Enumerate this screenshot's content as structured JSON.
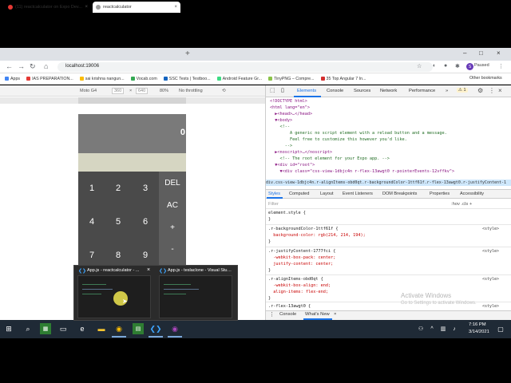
{
  "browser": {
    "tabs": [
      {
        "title": "(11) reactcalculator on Expo Dev..."
      },
      {
        "title": "reactcalculator"
      }
    ],
    "new_tab_glyph": "+",
    "url": "localhost:19006",
    "profile_initial": "S",
    "profile_status": "Paused",
    "bookmarks": [
      {
        "label": "Apps",
        "color": "#4285f4"
      },
      {
        "label": "IAS PREPARATION...",
        "color": "#e53935"
      },
      {
        "label": "sai krishna nangun...",
        "color": "#fbbc05"
      },
      {
        "label": "Vocab.com",
        "color": "#34a853"
      },
      {
        "label": "SSC Tests | Testboo...",
        "color": "#1565c0"
      },
      {
        "label": "Android Feature Gr...",
        "color": "#3ddc84"
      },
      {
        "label": "TinyPNG – Compre...",
        "color": "#8bc34a"
      },
      {
        "label": "35 Top Angular 7 In...",
        "color": "#d32f2f"
      }
    ],
    "other_bookmarks": "Other bookmarks"
  },
  "device_toolbar": {
    "device": "Moto G4",
    "width": "360",
    "height": "640",
    "zoom": "80%",
    "throttle": "No throttling"
  },
  "calculator": {
    "result": "0",
    "rows": [
      [
        "1",
        "2",
        "3"
      ],
      [
        "4",
        "5",
        "6"
      ],
      [
        "7",
        "8",
        "9"
      ]
    ],
    "operations": [
      "DEL",
      "AC",
      "+",
      "-"
    ]
  },
  "devtools": {
    "tabs": [
      "Elements",
      "Console",
      "Sources",
      "Network",
      "Performance"
    ],
    "more": "»",
    "warnings": "1",
    "dom_lines": [
      "<!DOCTYPE html>",
      "<html lang=\"en\">",
      "  ▶<head>…</head>",
      "  ▼<body>",
      "    <!--",
      "        A generic no script element with a reload button and a message.",
      "        Feel free to customize this however you'd like.",
      "      -->",
      "  ▶<noscript>…</noscript>",
      "    <!-- The root element for your Expo app. -->",
      "  ▼<div id=\"root\">",
      "    ▼<div class=\"css-view-1dbjc4n r-flex-13awgt0 r-pointerEvents-12vffkv\">"
    ],
    "breadcrumb": "div.css-view-1dbjc4n.r-alignItems-obd0qt.r-backgroundColor-1ttf61f.r-flex-13awgt0.r-justifyContent-1",
    "style_tabs": [
      "Styles",
      "Computed",
      "Layout",
      "Event Listeners",
      "DOM Breakpoints",
      "Properties",
      "Accessibility"
    ],
    "filter_placeholder": "Filter",
    "filter_tools": ":hov  .cls  +",
    "rules": [
      {
        "selector": "element.style {",
        "props": [],
        "close": "}",
        "origin": ""
      },
      {
        "selector": ".r-backgroundColor-1ttf61f {",
        "props": [
          "  background-color: rgb(214, 214, 194);"
        ],
        "close": "}",
        "origin": "<style>"
      },
      {
        "selector": ".r-justifyContent-1777fci {",
        "props": [
          "  -webkit-box-pack: center;",
          "  justify-content: center;"
        ],
        "close": "}",
        "origin": "<style>"
      },
      {
        "selector": ".r-alignItems-obd0qt {",
        "props": [
          "  -webkit-box-align: end;",
          "  align-items: flex-end;"
        ],
        "close": "}",
        "origin": "<style>"
      },
      {
        "selector": ".r-flex-13awgt0 {",
        "props": [],
        "close": "",
        "origin": "<style>"
      }
    ],
    "watermark_title": "Activate Windows",
    "watermark_sub": "Go to Settings to activate Windows.",
    "drawer_tabs": [
      "Console",
      "What's New"
    ],
    "drawer_close": "×"
  },
  "taskbar": {
    "thumbnails": [
      {
        "title": "App.js - reactcalculator - ..."
      },
      {
        "title": "App.js - teslaclone - Visual Stud..."
      }
    ],
    "time": "7:16 PM",
    "date": "3/14/2021"
  }
}
